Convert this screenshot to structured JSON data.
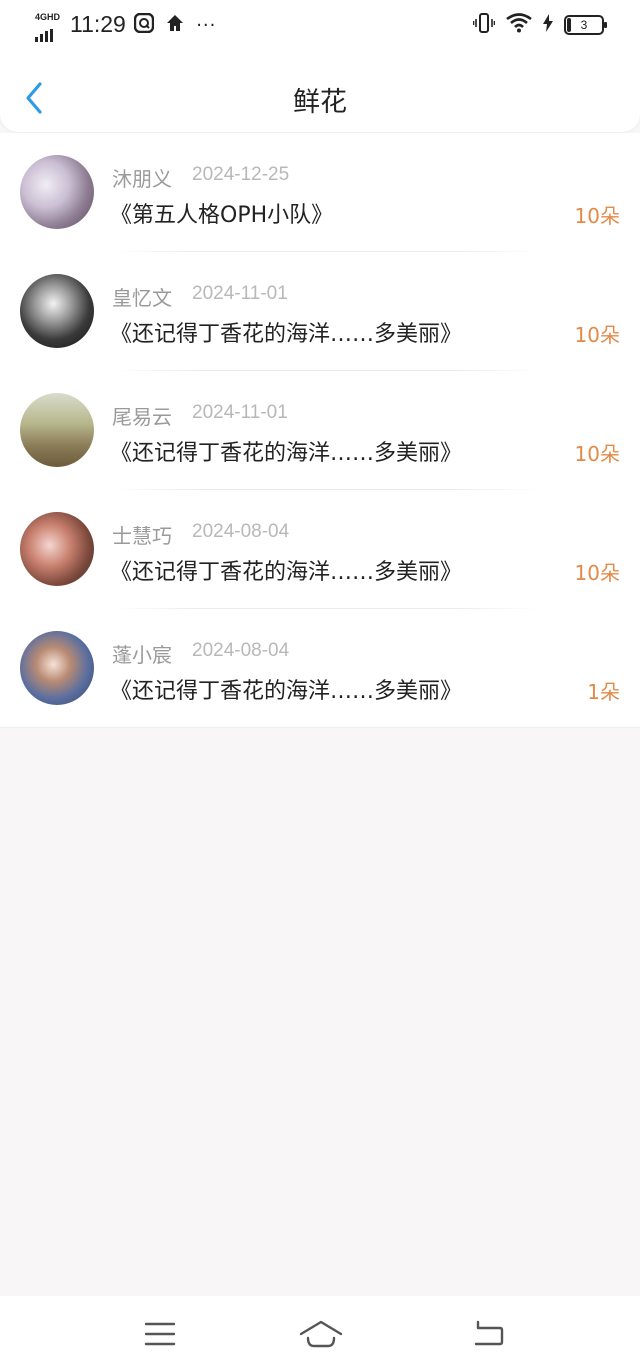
{
  "status_bar": {
    "network": "4GHD",
    "time": "11:29",
    "battery": "3",
    "more": "···"
  },
  "header": {
    "title": "鲜花"
  },
  "items": [
    {
      "name": "沐朋义",
      "date": "2024-12-25",
      "title": "《第五人格OPH小队》",
      "count": "10朵"
    },
    {
      "name": "皇忆文",
      "date": "2024-11-01",
      "title": "《还记得丁香花的海洋……多美丽》",
      "count": "10朵"
    },
    {
      "name": "尾易云",
      "date": "2024-11-01",
      "title": "《还记得丁香花的海洋……多美丽》",
      "count": "10朵"
    },
    {
      "name": "士慧巧",
      "date": "2024-08-04",
      "title": "《还记得丁香花的海洋……多美丽》",
      "count": "10朵"
    },
    {
      "name": "蓬小宸",
      "date": "2024-08-04",
      "title": "《还记得丁香花的海洋……多美丽》",
      "count": "1朵"
    }
  ],
  "colors": {
    "accent": "#2f9be6",
    "count": "#e38a48",
    "background": "#f8f6f7"
  },
  "icons": {
    "back": "chevron-left-icon",
    "nav_menu": "menu-icon",
    "nav_home": "home-icon",
    "nav_back": "back-icon"
  }
}
